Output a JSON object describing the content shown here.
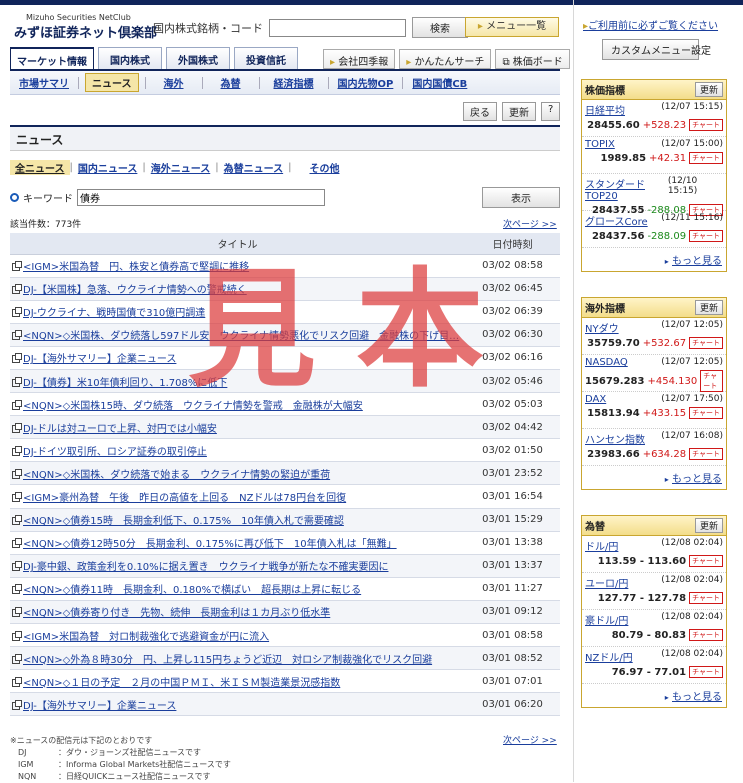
{
  "header": {
    "logo_en": "Mizuho Securities NetClub",
    "logo_jp": "みずほ証券ネット倶楽部",
    "search_label": "国内株式銘柄・コード",
    "search_value": "",
    "search_button": "検索",
    "menu_button": "メニュー一覧"
  },
  "tabs": [
    "マーケット情報",
    "国内株式",
    "外国株式",
    "投資信託"
  ],
  "right_tabs": [
    "会社四季報",
    "かんたんサーチ",
    "株価ボード"
  ],
  "subnav": [
    "市場サマリ",
    "ニュース",
    "海外",
    "為替",
    "経済指標",
    "国内先物OP",
    "国内国債CB"
  ],
  "actions": {
    "back": "戻る",
    "refresh": "更新",
    "help": "?"
  },
  "page_title": "ニュース",
  "categories": [
    "全ニュース",
    "国内ニュース",
    "海外ニュース",
    "為替ニュース",
    "その他"
  ],
  "keyword": {
    "label": "キーワード",
    "value": "債券",
    "button": "表示"
  },
  "count": "該当件数：773件",
  "next_page": "次ページ >>",
  "table": {
    "headers": [
      "タイトル",
      "日付時刻"
    ],
    "rows": [
      {
        "title": "<IGM>米国為替　円、株安と債券高で堅調に推移",
        "date": "03/02 08:58"
      },
      {
        "title": "DJ-【米国株】急落、ウクライナ情勢への警戒続く",
        "date": "03/02 06:45"
      },
      {
        "title": "DJ-ウクライナ、戦時国債で310億円調達",
        "date": "03/02 06:39"
      },
      {
        "title": "<NQN>◇米国株、ダウ続落し597ドル安　ウクライナ情勢悪化でリスク回避　金融株の下げ目…",
        "date": "03/02 06:30"
      },
      {
        "title": "DJ-【海外サマリー】企業ニュース",
        "date": "03/02 06:16"
      },
      {
        "title": "DJ-【債券】米10年債利回り、1.708%に低下",
        "date": "03/02 05:46"
      },
      {
        "title": "<NQN>◇米国株15時、ダウ続落　ウクライナ情勢を警戒　金融株が大幅安",
        "date": "03/02 05:03"
      },
      {
        "title": "DJ-ドルは対ユーロで上昇、対円では小幅安",
        "date": "03/02 04:42"
      },
      {
        "title": "DJ-ドイツ取引所、ロシア証券の取引停止",
        "date": "03/02 01:50"
      },
      {
        "title": "<NQN>◇米国株、ダウ続落で始まる　ウクライナ情勢の緊迫が重荷",
        "date": "03/01 23:52"
      },
      {
        "title": "<IGM>豪州為替　午後　昨日の高値を上回る　NZドルは78円台を回復",
        "date": "03/01 16:54"
      },
      {
        "title": "<NQN>◇債券15時　長期金利低下、0.175%　10年債入札で需要確認",
        "date": "03/01 15:29"
      },
      {
        "title": "<NQN>◇債券12時50分　長期金利、0.175%に再び低下　10年債入札は「無難」",
        "date": "03/01 13:38"
      },
      {
        "title": "DJ-豪中銀、政策金利を0.10%に据え置き　ウクライナ戦争が新たな不確実要因に",
        "date": "03/01 13:37"
      },
      {
        "title": "<NQN>◇債券11時　長期金利、0.180%で横ばい　超長期は上昇に転じる",
        "date": "03/01 11:27"
      },
      {
        "title": "<NQN>◇債券寄り付き　先物、続伸　長期金利は１カ月ぶり低水準",
        "date": "03/01 09:12"
      },
      {
        "title": "<IGM>米国為替　対ロ制裁強化で逃避資金が円に流入",
        "date": "03/01 08:58"
      },
      {
        "title": "<NQN>◇外為８時30分　円、上昇し115円ちょうど近辺　対ロシア制裁強化でリスク回避",
        "date": "03/01 08:52"
      },
      {
        "title": "<NQN>◇１日の予定　２月の中国ＰＭＩ、米ＩＳＭ製造業景況感指数",
        "date": "03/01 07:01"
      },
      {
        "title": "DJ-【海外サマリー】企業ニュース",
        "date": "03/01 06:20"
      }
    ]
  },
  "notes": {
    "intro": "※ニュースの配信元は下記のとおりです",
    "sources": [
      {
        "k": "DJ",
        "v": "：ダウ・ジョーンズ社配信ニュースです"
      },
      {
        "k": "IGM",
        "v": "：Informa Global Markets社配信ニュースです"
      },
      {
        "k": "NQN",
        "v": "：日経QUICKニュース社配信ニュースです"
      }
    ]
  },
  "watermark": "見本",
  "sidebar": {
    "notice": "ご利用前に必ずご覧ください",
    "custom_menu": "カスタムメニュー設定",
    "refresh": "更新",
    "chart": "チャート",
    "more": "もっと見る",
    "stocks": {
      "title": "株価指標",
      "items": [
        {
          "name": "日経平均",
          "time": "(12/07 15:15)",
          "value": "28455.60",
          "change": "+528.23",
          "dir": "up"
        },
        {
          "name": "TOPIX",
          "time": "(12/07 15:00)",
          "value": "1989.85",
          "change": "+42.31",
          "dir": "up"
        },
        {
          "name": "スタンダードTOP20",
          "time": "(12/10 15:15)",
          "value": "28437.55",
          "change": "-288.08",
          "dir": "dn"
        },
        {
          "name": "グロースCore",
          "time": "(12/11 15:16)",
          "value": "28437.56",
          "change": "-288.09",
          "dir": "dn"
        }
      ]
    },
    "overseas": {
      "title": "海外指標",
      "items": [
        {
          "name": "NYダウ",
          "time": "(12/07 12:05)",
          "value": "35759.70",
          "change": "+532.67",
          "dir": "up"
        },
        {
          "name": "NASDAQ",
          "time": "(12/07 12:05)",
          "value": "15679.283",
          "change": "+454.130",
          "dir": "up"
        },
        {
          "name": "DAX",
          "time": "(12/07 17:50)",
          "value": "15813.94",
          "change": "+433.15",
          "dir": "up"
        },
        {
          "name": "ハンセン指数",
          "time": "(12/07 16:08)",
          "value": "23983.66",
          "change": "+634.28",
          "dir": "up"
        }
      ]
    },
    "fx": {
      "title": "為替",
      "items": [
        {
          "name": "ドル/円",
          "time": "(12/08 02:04)",
          "value": "113.59 - 113.60"
        },
        {
          "name": "ユーロ/円",
          "time": "(12/08 02:04)",
          "value": "127.77 - 127.78"
        },
        {
          "name": "豪ドル/円",
          "time": "(12/08 02:04)",
          "value": "80.79 - 80.83"
        },
        {
          "name": "NZドル/円",
          "time": "(12/08 02:04)",
          "value": "76.97 - 77.01"
        }
      ]
    }
  }
}
